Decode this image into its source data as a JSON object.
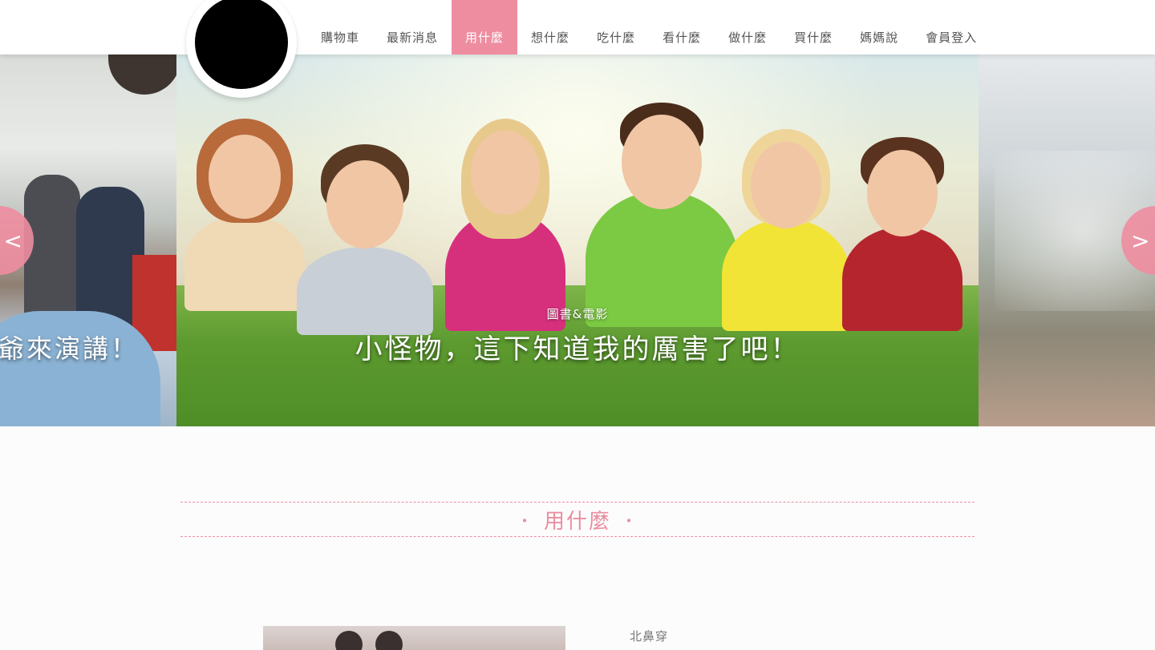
{
  "nav": {
    "items": [
      {
        "label": "購物車",
        "active": false
      },
      {
        "label": "最新消息",
        "active": false
      },
      {
        "label": "用什麼",
        "active": true
      },
      {
        "label": "想什麼",
        "active": false
      },
      {
        "label": "吃什麼",
        "active": false
      },
      {
        "label": "看什麼",
        "active": false
      },
      {
        "label": "做什麼",
        "active": false
      },
      {
        "label": "買什麼",
        "active": false
      },
      {
        "label": "媽媽說",
        "active": false
      },
      {
        "label": "會員登入",
        "active": false
      }
    ]
  },
  "slider": {
    "prev_caption": "爺來演講！",
    "current": {
      "category": "圖書&電影",
      "title": "小怪物，這下知道我的厲害了吧！"
    },
    "prev_arrow": "<",
    "next_arrow": ">"
  },
  "section": {
    "title": "用什麼",
    "dot": "・"
  },
  "article": {
    "meta": "北鼻穿"
  },
  "colors": {
    "accent": "#ee8da0",
    "heading": "#ea8ea0",
    "nav_text": "#555555"
  }
}
